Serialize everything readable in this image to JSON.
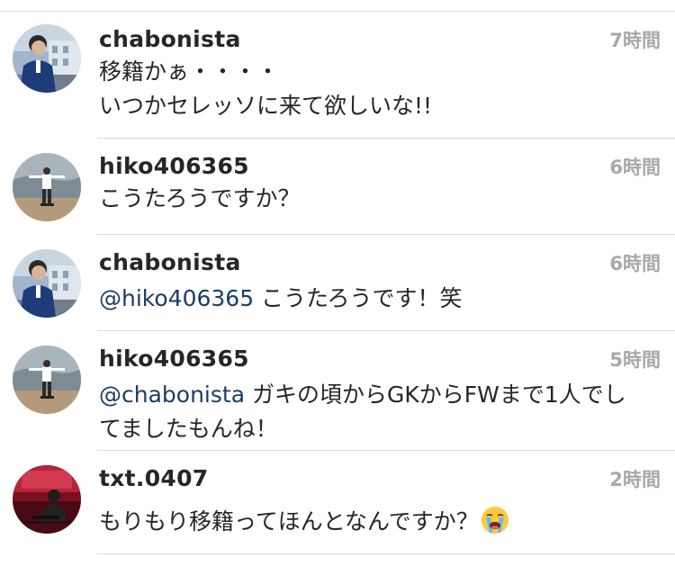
{
  "comments": [
    {
      "username": "chabonista",
      "time": "7時間",
      "mention": "",
      "lines": [
        "移籍かぁ・・・・",
        "いつかセレッソに来て欲しいな!!"
      ]
    },
    {
      "username": "hiko406365",
      "time": "6時間",
      "mention": "",
      "lines": [
        "こうたろうですか？"
      ]
    },
    {
      "username": "chabonista",
      "time": "6時間",
      "mention": "@hiko406365",
      "lines": [
        " こうたろうです！笑"
      ]
    },
    {
      "username": "hiko406365",
      "time": "5時間",
      "mention": "@chabonista",
      "lines": [
        " ガキの頃からGKからFWまで1人でし",
        "てましたもんね！"
      ]
    },
    {
      "username": "txt.0407",
      "time": "2時間",
      "mention": "",
      "lines": [
        "もりもり移籍ってほんとなんですか？"
      ]
    }
  ],
  "icons": {
    "crying_emoji": "loudly-crying-face-icon"
  },
  "colors": {
    "username": "#262626",
    "time": "#a8a8a8",
    "mention": "#1c3d63",
    "divider": "#dbdbdb"
  }
}
